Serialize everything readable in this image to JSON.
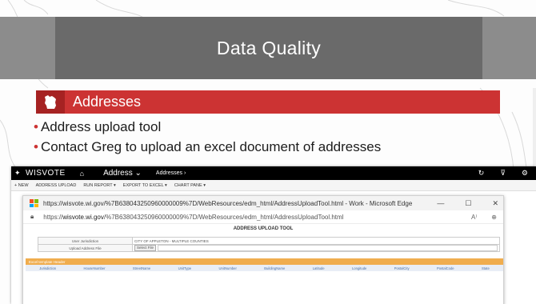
{
  "slide": {
    "title": "Data Quality",
    "section": {
      "label": "Addresses",
      "icon": "wisconsin-state-icon",
      "color": "#cc3333"
    },
    "bullets": [
      "Address upload tool",
      "Contact Greg to upload an excel document of addresses"
    ]
  },
  "app": {
    "brand": "WISVOTE",
    "area": "Address",
    "area_caret": "⌄",
    "breadcrumb": "Addresses  ›",
    "commands": [
      "+ NEW",
      "ADDRESS UPLOAD",
      "RUN REPORT ▾",
      "EXPORT TO EXCEL ▾",
      "CHART PANE ▾"
    ],
    "browser": {
      "window_title": "https://wisvote.wi.gov/%7B638043250960000009%7D/WebResources/edm_html/AddressUploadTool.html - Work - Microsoft Edge",
      "url_prefix": "https://",
      "url_host": "wisvote.wi.gov",
      "url_path": "/%7B638043250960000009%7D/WebResources/edm_html/AddressUploadTool.html",
      "tool_title": "ADDRESS UPLOAD TOOL",
      "form": {
        "user_jurisdiction_label": "User Jurisdiction",
        "user_jurisdiction_value": "CITY OF APPLETON - MULTIPLE COUNTIES",
        "upload_label": "Upload Address File",
        "select_file": "Select File"
      },
      "sheet_header": "Excel template Header",
      "columns": [
        "Jurisdiction",
        "HouseNumber",
        "StreetName",
        "UnitType",
        "UnitNumber",
        "BuildingName",
        "Latitude",
        "Longitude",
        "PostalCity",
        "PostalCode",
        "State"
      ]
    }
  }
}
